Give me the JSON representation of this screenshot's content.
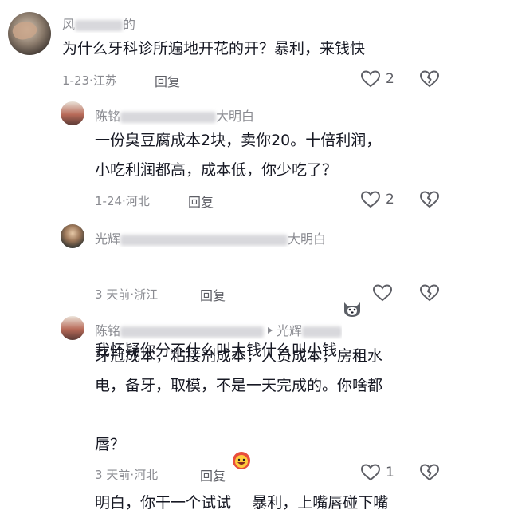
{
  "comments": [
    {
      "author_visible": "风",
      "author_tail": "的",
      "text": "为什么牙科诊所遍地开花的开？暴利，来钱快",
      "date": "1-23",
      "location": "江苏",
      "reply_label": "回复",
      "likes": "2"
    },
    {
      "author_visible": "陈铭",
      "author_tail": "大明白",
      "text_line1": "一份臭豆腐成本2块，卖你20。十倍利润，",
      "text_line2": "小吃利润都高，成本低，你少吃了？",
      "date": "1-24",
      "location": "河北",
      "reply_label": "回复",
      "likes": "2"
    },
    {
      "author_visible": "光辉",
      "author_tail": "大明白",
      "text": "我怀疑你分不什么叫大钱什么叫小钱",
      "date": "3 天前",
      "location": "浙江",
      "reply_label": "回复",
      "likes": ""
    },
    {
      "author_visible": "陈铭",
      "author_tail": "光辉",
      "text_line1": "牙冠成本，粘接剂成本，人员成本，房租水",
      "text_line2": "电，备牙，取模，不是一天完成的。你啥都",
      "text_line3a": "明白，你干一个试试",
      "text_line3b": "暴利，上嘴唇碰下嘴",
      "text_line4": "唇？",
      "date": "3 天前",
      "location": "河北",
      "reply_label": "回复",
      "likes": "1"
    }
  ],
  "separator": "·",
  "icons": {
    "like": "heart-outline-icon",
    "dislike": "broken-heart-icon",
    "arrow": "triangle-right-icon"
  },
  "colors": {
    "text": "#161823",
    "meta": "#8a8b91",
    "icon": "#5e5f66"
  }
}
